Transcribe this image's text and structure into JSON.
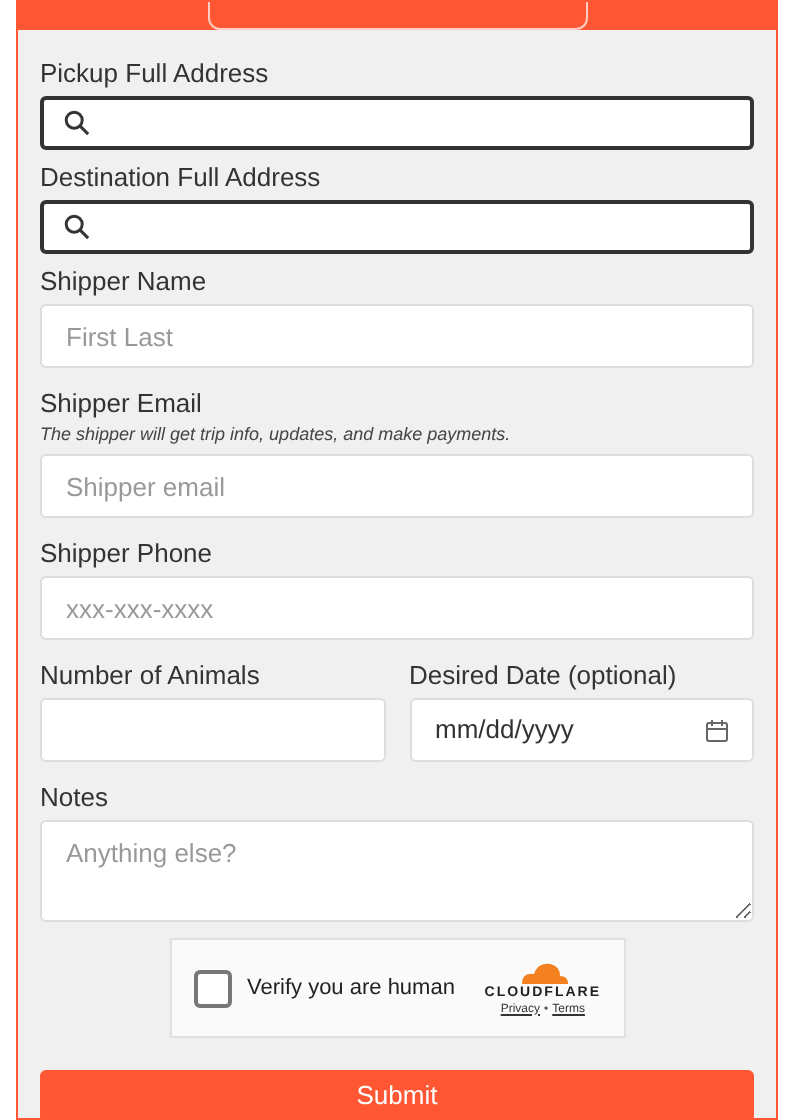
{
  "fields": [
    {
      "kind": "search",
      "label": "Pickup Full Address"
    },
    {
      "kind": "search",
      "label": "Destination Full Address"
    },
    {
      "kind": "text",
      "label": "Shipper Name",
      "placeholder": "First Last"
    },
    {
      "kind": "text",
      "label": "Shipper Email",
      "hint": "The shipper will get trip info, updates, and make payments.",
      "placeholder": "Shipper email"
    },
    {
      "kind": "text",
      "label": "Shipper Phone",
      "placeholder": "xxx-xxx-xxxx"
    }
  ],
  "row": [
    {
      "kind": "text",
      "label": "Number of Animals"
    },
    {
      "kind": "date",
      "label": "Desired Date (optional)",
      "placeholder": "mm/dd/yyyy"
    }
  ],
  "notes": {
    "label": "Notes",
    "placeholder": "Anything else?"
  },
  "captcha": {
    "checked": false,
    "label": "Verify you are human",
    "brand": "CLOUDFLARE",
    "links": [
      "Privacy",
      "Terms"
    ],
    "separator": "•"
  },
  "submit": "Submit"
}
